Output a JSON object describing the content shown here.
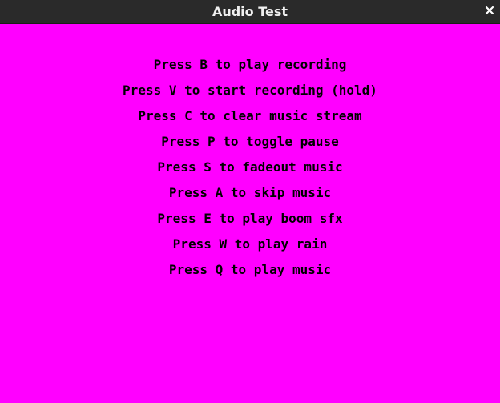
{
  "window": {
    "title": "Audio Test",
    "close_icon": "close-icon",
    "background_color": "#ff00ff",
    "text_color": "#000000"
  },
  "instructions": [
    "Press B to play recording",
    "Press V to start recording (hold)",
    "Press C to clear music stream",
    "Press P to toggle pause",
    "Press S to fadeout music",
    "Press A to skip music",
    "Press E to play boom sfx",
    "Press W to play rain",
    "Press Q to play music"
  ]
}
